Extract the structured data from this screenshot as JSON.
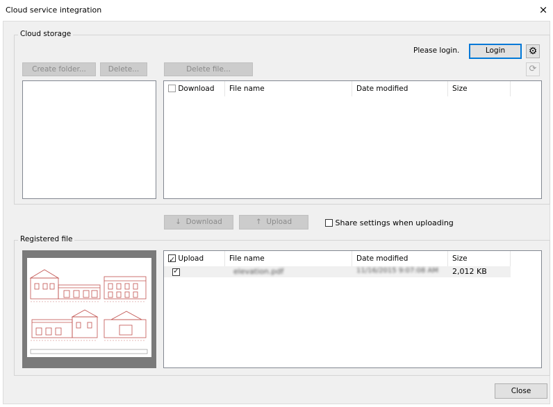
{
  "window": {
    "title": "Cloud service integration",
    "close_glyph": "×"
  },
  "cloud_storage": {
    "group_label": "Cloud storage",
    "status": "Please login.",
    "login_label": "Login",
    "settings_icon": "gear-icon",
    "refresh_icon": "refresh-icon",
    "create_folder_label": "Create folder...",
    "delete_label": "Delete...",
    "delete_file_label": "Delete file...",
    "columns": [
      "Download",
      "File name",
      "Date modified",
      "Size"
    ]
  },
  "transfer": {
    "download_label": "Download",
    "upload_label": "Upload",
    "download_icon": "↓",
    "upload_icon": "↑",
    "share_label": "Share settings when uploading",
    "share_checked": false
  },
  "registered": {
    "group_label": "Registered file",
    "columns": [
      "Upload",
      "File name",
      "Date modified",
      "Size"
    ],
    "rows": [
      {
        "checked": true,
        "file_name": "elevation.pdf",
        "date_modified": "11/16/2015 9:07:08 AM",
        "size": "2,012 KB"
      }
    ]
  },
  "footer": {
    "close_label": "Close"
  },
  "colors": {
    "accent": "#0078d7",
    "preview_bg": "#7a7a7a",
    "drawing": "#c0504d"
  }
}
